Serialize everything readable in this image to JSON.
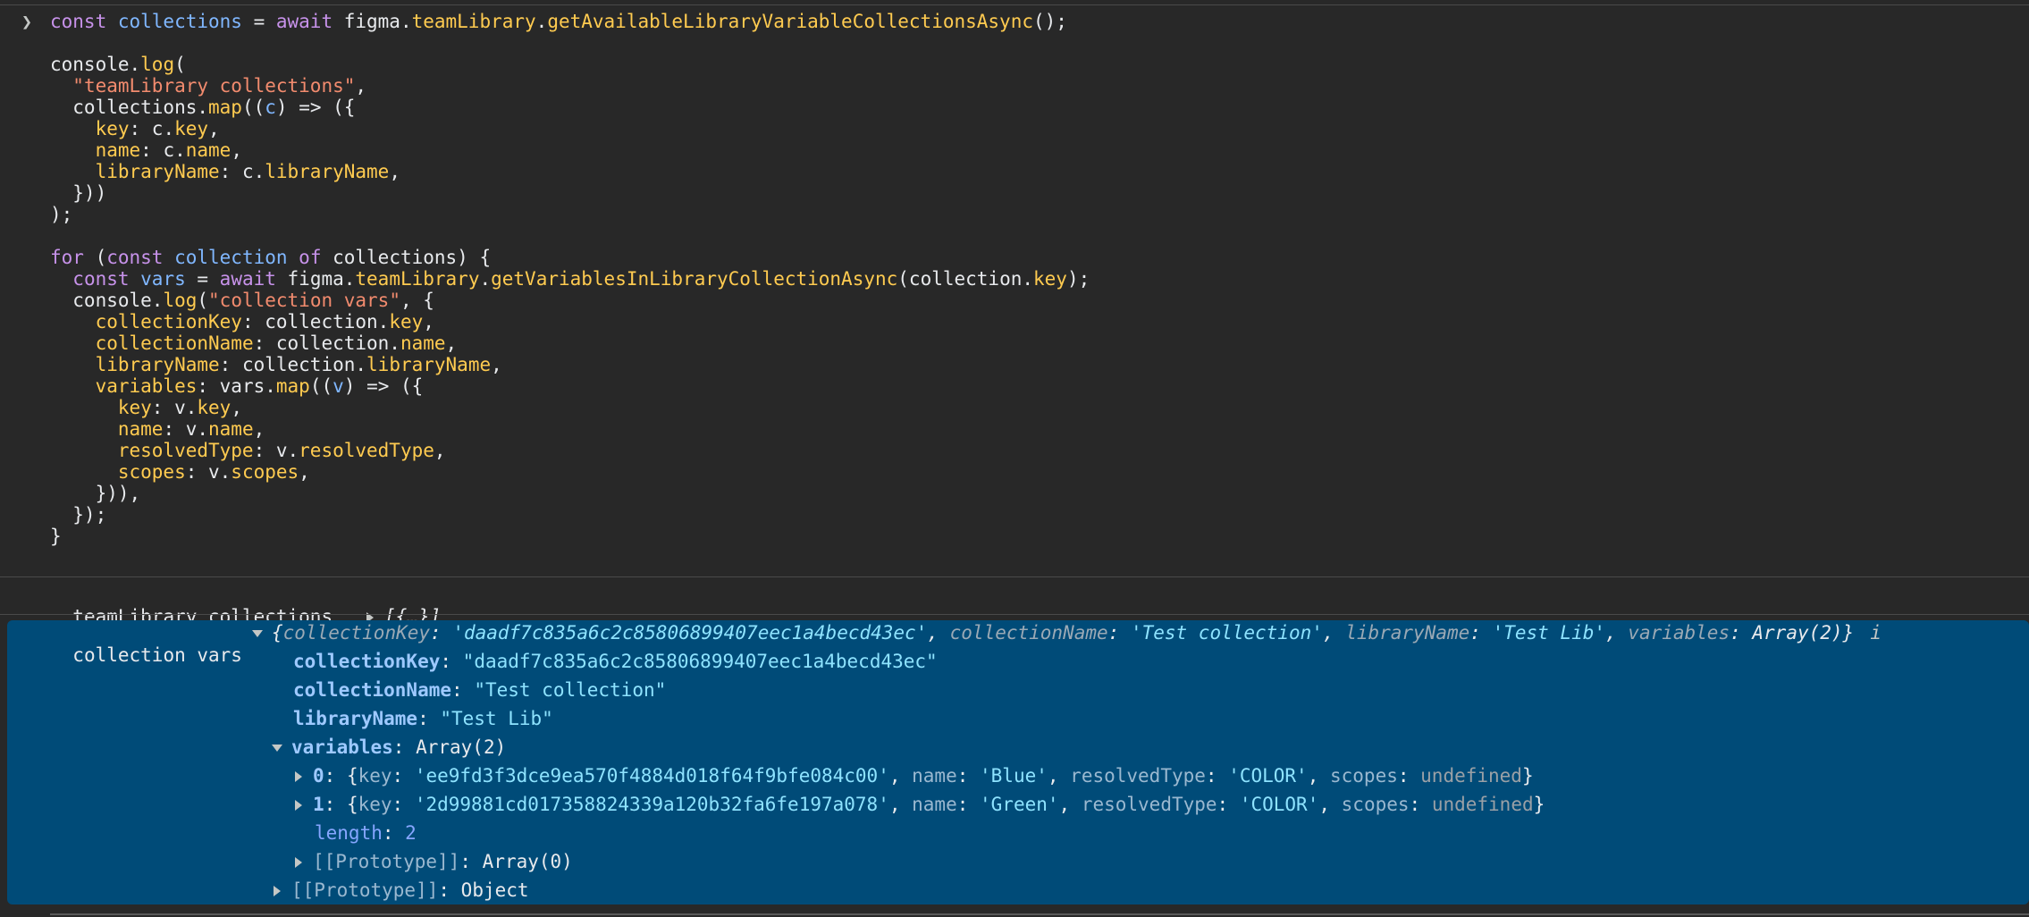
{
  "code_lines": [
    [
      [
        "kw",
        "const "
      ],
      [
        "var",
        "collections"
      ],
      [
        "plain",
        " = "
      ],
      [
        "kw",
        "await "
      ],
      [
        "plain",
        "figma."
      ],
      [
        "fn",
        "teamLibrary"
      ],
      [
        "plain",
        "."
      ],
      [
        "fn",
        "getAvailableLibraryVariableCollectionsAsync"
      ],
      [
        "plain",
        "();"
      ]
    ],
    [],
    [
      [
        "plain",
        "console."
      ],
      [
        "fn",
        "log"
      ],
      [
        "plain",
        "("
      ]
    ],
    [
      [
        "plain",
        "  "
      ],
      [
        "str",
        "\"teamLibrary collections\""
      ],
      [
        "plain",
        ","
      ]
    ],
    [
      [
        "plain",
        "  collections."
      ],
      [
        "fn",
        "map"
      ],
      [
        "plain",
        "(("
      ],
      [
        "var",
        "c"
      ],
      [
        "plain",
        ") => ({"
      ]
    ],
    [
      [
        "plain",
        "    "
      ],
      [
        "fn",
        "key"
      ],
      [
        "plain",
        ": c."
      ],
      [
        "fn",
        "key"
      ],
      [
        "plain",
        ","
      ]
    ],
    [
      [
        "plain",
        "    "
      ],
      [
        "fn",
        "name"
      ],
      [
        "plain",
        ": c."
      ],
      [
        "fn",
        "name"
      ],
      [
        "plain",
        ","
      ]
    ],
    [
      [
        "plain",
        "    "
      ],
      [
        "fn",
        "libraryName"
      ],
      [
        "plain",
        ": c."
      ],
      [
        "fn",
        "libraryName"
      ],
      [
        "plain",
        ","
      ]
    ],
    [
      [
        "plain",
        "  }))"
      ]
    ],
    [
      [
        "plain",
        ");"
      ]
    ],
    [],
    [
      [
        "kw",
        "for "
      ],
      [
        "plain",
        "("
      ],
      [
        "kw",
        "const "
      ],
      [
        "var",
        "collection "
      ],
      [
        "kw",
        "of "
      ],
      [
        "plain",
        "collections) {"
      ]
    ],
    [
      [
        "plain",
        "  "
      ],
      [
        "kw",
        "const "
      ],
      [
        "var",
        "vars"
      ],
      [
        "plain",
        " = "
      ],
      [
        "kw",
        "await "
      ],
      [
        "plain",
        "figma."
      ],
      [
        "fn",
        "teamLibrary"
      ],
      [
        "plain",
        "."
      ],
      [
        "fn",
        "getVariablesInLibraryCollectionAsync"
      ],
      [
        "plain",
        "(collection."
      ],
      [
        "fn",
        "key"
      ],
      [
        "plain",
        ");"
      ]
    ],
    [
      [
        "plain",
        "  console."
      ],
      [
        "fn",
        "log"
      ],
      [
        "plain",
        "("
      ],
      [
        "str",
        "\"collection vars\""
      ],
      [
        "plain",
        ", {"
      ]
    ],
    [
      [
        "plain",
        "    "
      ],
      [
        "fn",
        "collectionKey"
      ],
      [
        "plain",
        ": collection."
      ],
      [
        "fn",
        "key"
      ],
      [
        "plain",
        ","
      ]
    ],
    [
      [
        "plain",
        "    "
      ],
      [
        "fn",
        "collectionName"
      ],
      [
        "plain",
        ": collection."
      ],
      [
        "fn",
        "name"
      ],
      [
        "plain",
        ","
      ]
    ],
    [
      [
        "plain",
        "    "
      ],
      [
        "fn",
        "libraryName"
      ],
      [
        "plain",
        ": collection."
      ],
      [
        "fn",
        "libraryName"
      ],
      [
        "plain",
        ","
      ]
    ],
    [
      [
        "plain",
        "    "
      ],
      [
        "fn",
        "variables"
      ],
      [
        "plain",
        ": vars."
      ],
      [
        "fn",
        "map"
      ],
      [
        "plain",
        "(("
      ],
      [
        "var",
        "v"
      ],
      [
        "plain",
        ") => ({"
      ]
    ],
    [
      [
        "plain",
        "      "
      ],
      [
        "fn",
        "key"
      ],
      [
        "plain",
        ": v."
      ],
      [
        "fn",
        "key"
      ],
      [
        "plain",
        ","
      ]
    ],
    [
      [
        "plain",
        "      "
      ],
      [
        "fn",
        "name"
      ],
      [
        "plain",
        ": v."
      ],
      [
        "fn",
        "name"
      ],
      [
        "plain",
        ","
      ]
    ],
    [
      [
        "plain",
        "      "
      ],
      [
        "fn",
        "resolvedType"
      ],
      [
        "plain",
        ": v."
      ],
      [
        "fn",
        "resolvedType"
      ],
      [
        "plain",
        ","
      ]
    ],
    [
      [
        "plain",
        "      "
      ],
      [
        "fn",
        "scopes"
      ],
      [
        "plain",
        ": v."
      ],
      [
        "fn",
        "scopes"
      ],
      [
        "plain",
        ","
      ]
    ],
    [
      [
        "plain",
        "    })),"
      ]
    ],
    [
      [
        "plain",
        "  });"
      ]
    ],
    [
      [
        "plain",
        "}"
      ]
    ]
  ],
  "log_collections": {
    "label": "teamLibrary collections",
    "preview": "[{…}]"
  },
  "log_vars": {
    "label": "collection vars",
    "summary_open": "{",
    "k_collectionKey": "collectionKey",
    "v_collectionKey": "'daadf7c835a6c2c85806899407eec1a4becd43ec'",
    "k_collectionName": "collectionName",
    "v_collectionName": "'Test collection'",
    "k_libraryName": "libraryName",
    "v_libraryName": "'Test Lib'",
    "k_variables": "variables",
    "v_variables": "Array(2)",
    "summary_close": "}",
    "info": "i",
    "full_collectionKey": "\"daadf7c835a6c2c85806899407eec1a4becd43ec\"",
    "full_collectionName": "\"Test collection\"",
    "full_libraryName": "\"Test Lib\"",
    "variables_array": "Array(2)",
    "item0_index": "0",
    "item0_key": "'ee9fd3f3dce9ea570f4884d018f64f9bfe084c00'",
    "item0_name": "'Blue'",
    "item0_type": "'COLOR'",
    "item1_index": "1",
    "item1_key": "'2d99881cd017358824339a120b32fa6fe197a078'",
    "item1_name": "'Green'",
    "item1_type": "'COLOR'",
    "undefined_text": "undefined",
    "length_key": "length",
    "length_val": "2",
    "proto_key": "[[Prototype]]",
    "proto_array": "Array(0)",
    "proto_object": "Object",
    "key_label": "key",
    "name_label": "name",
    "resolvedType_label": "resolvedType",
    "scopes_label": "scopes"
  }
}
